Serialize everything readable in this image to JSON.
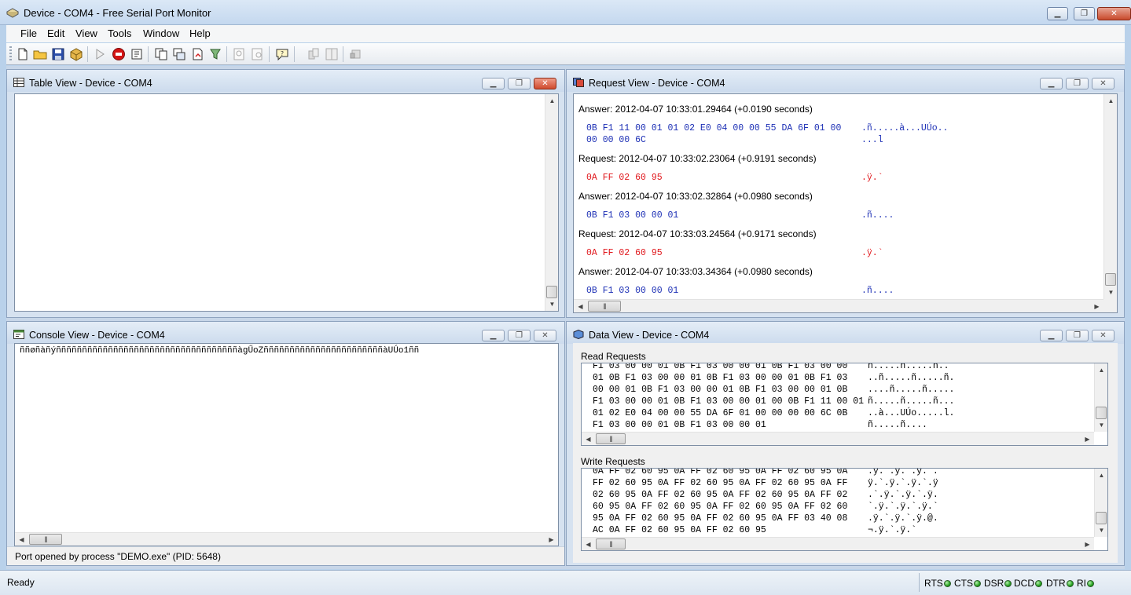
{
  "window": {
    "title": "Device - COM4 - Free Serial Port Monitor",
    "controls": {
      "minimize": "▁",
      "maximize": "❐",
      "close": "✕"
    }
  },
  "menu": [
    "File",
    "Edit",
    "View",
    "Tools",
    "Window",
    "Help"
  ],
  "panels": {
    "table_view": {
      "title": "Table View - Device - COM4"
    },
    "request_view": {
      "title": "Request View - Device - COM4",
      "entries": [
        {
          "header": "Answer: 2012-04-07 10:33:01.29464 (+0.0190 seconds)",
          "kind": "answer",
          "hex": [
            "0B F1 11 00 01 01 02 E0 04 00 00 55 DA 6F 01 00",
            "00 00 00 6C"
          ],
          "ascii": [
            ".ñ.....à...UÚo..",
            "...l"
          ]
        },
        {
          "header": "Request: 2012-04-07 10:33:02.23064 (+0.9191 seconds)",
          "kind": "request",
          "hex": [
            "0A FF 02 60 95"
          ],
          "ascii": [
            ".ÿ.`"
          ]
        },
        {
          "header": "Answer: 2012-04-07 10:33:02.32864 (+0.0980 seconds)",
          "kind": "answer",
          "hex": [
            "0B F1 03 00 00 01"
          ],
          "ascii": [
            ".ñ...."
          ]
        },
        {
          "header": "Request: 2012-04-07 10:33:03.24564 (+0.9171 seconds)",
          "kind": "request",
          "hex": [
            "0A FF 02 60 95"
          ],
          "ascii": [
            ".ÿ.`"
          ]
        },
        {
          "header": "Answer: 2012-04-07 10:33:03.34364 (+0.0980 seconds)",
          "kind": "answer",
          "hex": [
            "0B F1 03 00 00 01"
          ],
          "ascii": [
            ".ñ...."
          ]
        }
      ]
    },
    "console_view": {
      "title": "Console View - Device - COM4",
      "text": "ññøñàñýñññññññññññññññññññññññññññññññññññàgŰoZñññññññññññññññññññññññàUÚo1ññ",
      "status": "Port opened by process \"DEMO.exe\" (PID: 5648)"
    },
    "data_view": {
      "title": "Data View - Device - COM4",
      "read_label": "Read Requests",
      "read_lines": [
        {
          "hex": "F1 03 00 00 01 0B F1 03 00 00 01 0B F1 03 00 00",
          "ascii": "ñ.....ñ.....ñ.."
        },
        {
          "hex": "01 0B F1 03 00 00 01 0B F1 03 00 00 01 0B F1 03",
          "ascii": "..ñ.....ñ.....ñ."
        },
        {
          "hex": "00 00 01 0B F1 03 00 00 01 0B F1 03 00 00 01 0B",
          "ascii": "....ñ.....ñ....."
        },
        {
          "hex": "F1 03 00 00 01 0B F1 03 00 00 01 00 0B F1 11 00 01",
          "ascii": "ñ.....ñ.....ñ..."
        },
        {
          "hex": "01 02 E0 04 00 00 55 DA 6F 01 00 00 00 00 6C 0B",
          "ascii": "..à...UÚo.....l."
        },
        {
          "hex": "F1 03 00 00 01 0B F1 03 00 00 01",
          "ascii": "ñ.....ñ...."
        }
      ],
      "write_label": "Write Requests",
      "write_lines": [
        {
          "hex": "0A FF 02 60 95 0A FF 02 60 95 0A FF 02 60 95 0A",
          "ascii": ".ÿ.`.ÿ.`.ÿ.`."
        },
        {
          "hex": "FF 02 60 95 0A FF 02 60 95 0A FF 02 60 95 0A FF",
          "ascii": "ÿ.`.ÿ.`.ÿ.`.ÿ"
        },
        {
          "hex": "02 60 95 0A FF 02 60 95 0A FF 02 60 95 0A FF 02",
          "ascii": ".`.ÿ.`.ÿ.`.ÿ."
        },
        {
          "hex": "60 95 0A FF 02 60 95 0A FF 02 60 95 0A FF 02 60",
          "ascii": "`.ÿ.`.ÿ.`.ÿ.`"
        },
        {
          "hex": "95 0A FF 02 60 95 0A FF 02 60 95 0A FF 03 40 08",
          "ascii": ".ÿ.`.ÿ.`.ÿ.@."
        },
        {
          "hex": "AC 0A FF 02 60 95 0A FF 02 60 95",
          "ascii": "¬.ÿ.`.ÿ.`"
        }
      ]
    }
  },
  "statusbar": {
    "text": "Ready",
    "signals": [
      "RTS",
      "CTS",
      "DSR",
      "DCD",
      "DTR",
      "RI"
    ],
    "led_color": "#25a31f"
  },
  "colors": {
    "request_hex": "#e0161b",
    "answer_hex": "#1c2fb5"
  }
}
